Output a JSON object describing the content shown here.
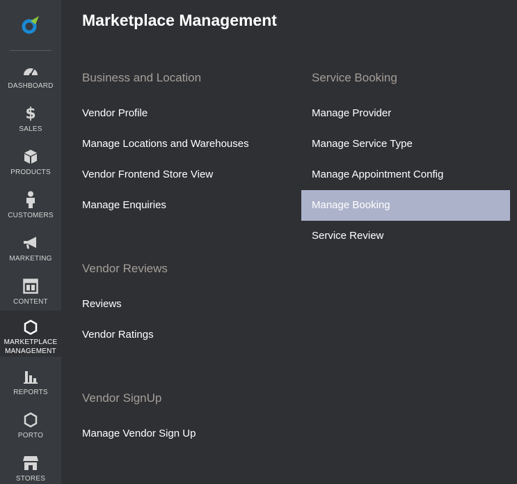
{
  "sidebar": {
    "items": [
      {
        "label": "DASHBOARD",
        "icon": "gauge-icon"
      },
      {
        "label": "SALES",
        "icon": "dollar-icon"
      },
      {
        "label": "PRODUCTS",
        "icon": "cube-icon"
      },
      {
        "label": "CUSTOMERS",
        "icon": "person-icon"
      },
      {
        "label": "MARKETING",
        "icon": "megaphone-icon"
      },
      {
        "label": "CONTENT",
        "icon": "layout-icon"
      },
      {
        "label": "MARKETPLACE",
        "label2": "MANAGEMENT",
        "icon": "hexagon-icon"
      },
      {
        "label": "REPORTS",
        "icon": "bar-chart-icon"
      },
      {
        "label": "PORTO",
        "icon": "hexagon-icon"
      },
      {
        "label": "STORES",
        "icon": "store-icon"
      }
    ],
    "active": "MARKETPLACE MANAGEMENT"
  },
  "page": {
    "title": "Marketplace Management"
  },
  "sections": {
    "business": {
      "title": "Business and Location",
      "links": [
        "Vendor Profile",
        "Manage Locations and Warehouses",
        "Vendor Frontend Store View",
        "Manage Enquiries"
      ]
    },
    "reviews": {
      "title": "Vendor Reviews",
      "links": [
        "Reviews",
        "Vendor Ratings"
      ]
    },
    "signup": {
      "title": "Vendor SignUp",
      "links": [
        "Manage Vendor Sign Up"
      ]
    },
    "booking": {
      "title": "Service Booking",
      "links": [
        "Manage Provider",
        "Manage Service Type",
        "Manage Appointment Config",
        "Manage Booking",
        "Service Review"
      ],
      "active": "Manage Booking"
    }
  },
  "colors": {
    "sidebar_bg": "#373a3e",
    "main_bg": "#2f3034",
    "highlight": "#acb2ca",
    "section_title": "#a59f98",
    "logo_blue": "#1a8ad3",
    "logo_green": "#8cc63f"
  }
}
